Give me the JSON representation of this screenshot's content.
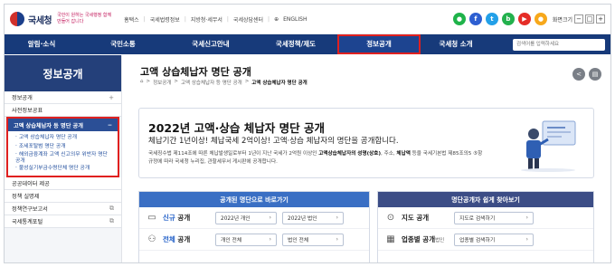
{
  "header": {
    "logo_text": "국세청",
    "slogan": "국민이 원하는 국세행정 함께 만들어 갑니다",
    "util_links": [
      "홈택스",
      "국세법령정보",
      "지방청·세무서",
      "국세상담센터",
      "ENGLISH"
    ],
    "social_icons": [
      {
        "name": "kakao-icon",
        "glyph": "●",
        "color": "#1fb34a"
      },
      {
        "name": "facebook-icon",
        "glyph": "f",
        "color": "#2d5fd1"
      },
      {
        "name": "twitter-icon",
        "glyph": "t",
        "color": "#23a0e8"
      },
      {
        "name": "blog-icon",
        "glyph": "b",
        "color": "#23b14d"
      },
      {
        "name": "youtube-icon",
        "glyph": "▶",
        "color": "#e52d27"
      },
      {
        "name": "kakao-story-icon",
        "glyph": "●",
        "color": "#f7a81b"
      }
    ],
    "zoom_label": "화면크기"
  },
  "nav": {
    "items": [
      {
        "label": "알림·소식",
        "width": 82
      },
      {
        "label": "국민소통",
        "width": 98
      },
      {
        "label": "국세신고안내",
        "width": 96
      },
      {
        "label": "국세정책/제도",
        "width": 92
      },
      {
        "label": "정보공개",
        "width": 92,
        "active": true
      },
      {
        "label": "국세청 소개",
        "width": 78
      }
    ],
    "search_placeholder": "검색어를 입력하세요"
  },
  "sidebar": {
    "title": "정보공개",
    "items_top": [
      "정보공개",
      "사전정보공표"
    ],
    "active_label": "고액 상습체납자 등 명단 공개",
    "sub_items": [
      "고액 상습체납자 명단 공개",
      "조세포탈범 명단 공개",
      "해외금융계좌 고액 신고의무 위반자 명단 공개",
      "불성실기부금수령단체 명단 공개"
    ],
    "items_bottom": [
      "공공데이터 제공",
      "정책 실명제",
      "정책연구보고서",
      "국세통계포털"
    ]
  },
  "content": {
    "title": "고액 상습체납자 명단 공개",
    "breadcrumb": [
      "정보공개",
      "고액 상습체납자 등 명단 공개",
      "고액 상습체납자 명단 공개"
    ],
    "hero": {
      "heading": "2022년 고액·상습 체납자 명단 공개",
      "subheading": "체납기간 1년이상! 체납국세 2억이상! 고액·상습 체납자의 명단을 공개합니다.",
      "desc_prefix": "국세징수법 제114조에 따른 체납발생일로부터 1년이 지난 국세가 2억원 이상인 ",
      "desc_bold1": "고액상습체납자의 성명(상호)",
      "desc_mid": ", 주소, ",
      "desc_bold2": "체납액",
      "desc_suffix": " 등을 국세기본법 제85조의5 ⑤항 규정에 따라 국세청 누리집, 관할세무서 게시판에 공개합니다."
    },
    "left_panel": {
      "title": "공개된 명단으로 바로가기",
      "rows": [
        {
          "label_a": "신규",
          "label_b": " 공개",
          "btn1": "2022년 개인",
          "btn2": "2022년 법인"
        },
        {
          "label_a": "전체",
          "label_b": " 공개",
          "btn1": "개인 전체",
          "btn2": "법인 전체"
        }
      ]
    },
    "right_panel": {
      "title": "명단공개자 쉽게 찾아보기",
      "rows": [
        {
          "label": "지도 공개",
          "btn": "지도로 검색하기"
        },
        {
          "label": "업종별 공개",
          "sub": "법인",
          "btn": "업종별 검색하기"
        }
      ]
    }
  }
}
